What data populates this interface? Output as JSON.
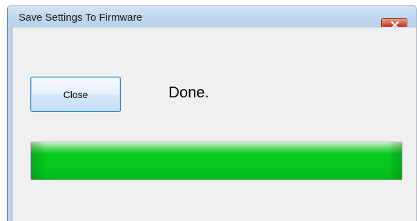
{
  "window": {
    "title": "Save Settings To Firmware"
  },
  "dialog": {
    "close_button_label": "Close",
    "status_text": "Done."
  },
  "progress": {
    "percent": 100,
    "fill_color": "#06c91e"
  },
  "icons": {
    "titlebar_close": "close-icon"
  },
  "colors": {
    "titlebar_close_button": "#c0392b",
    "close_button_border": "#3c7fb1"
  }
}
